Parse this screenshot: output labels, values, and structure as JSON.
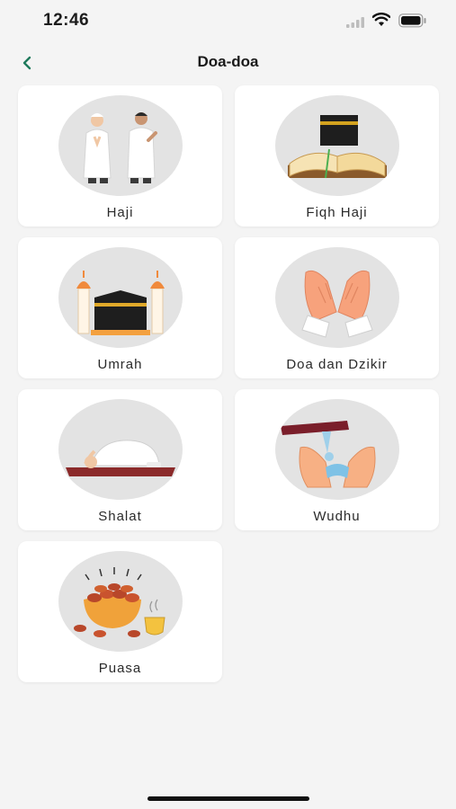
{
  "status_bar": {
    "time": "12:46",
    "signal_icon": "cellular-signal-icon",
    "wifi_icon": "wifi-icon",
    "battery_icon": "battery-icon"
  },
  "header": {
    "title": "Doa-doa",
    "back_icon": "chevron-left-icon",
    "accent_color": "#1f7a5c"
  },
  "categories": [
    {
      "label": "Haji",
      "icon": "pilgrims-icon"
    },
    {
      "label": "Fiqh Haji",
      "icon": "kaaba-book-icon"
    },
    {
      "label": "Umrah",
      "icon": "kaaba-minaret-icon"
    },
    {
      "label": "Doa dan Dzikir",
      "icon": "praying-hands-icon"
    },
    {
      "label": "Shalat",
      "icon": "prostration-icon"
    },
    {
      "label": "Wudhu",
      "icon": "ablution-icon"
    },
    {
      "label": "Puasa",
      "icon": "dates-bowl-icon"
    }
  ]
}
